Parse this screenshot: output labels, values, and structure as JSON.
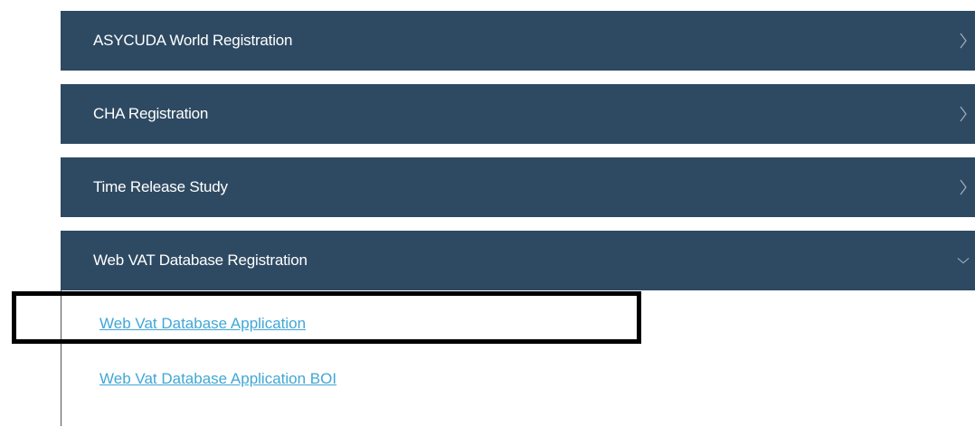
{
  "accordion": {
    "sections": [
      {
        "title": "ASYCUDA World Registration",
        "state": "collapsed",
        "icon": "chevron-right-icon"
      },
      {
        "title": "CHA Registration",
        "state": "collapsed",
        "icon": "chevron-right-icon"
      },
      {
        "title": "Time Release Study",
        "state": "collapsed",
        "icon": "chevron-right-icon"
      },
      {
        "title": "Web VAT Database Registration",
        "state": "expanded",
        "icon": "chevron-down-icon"
      }
    ],
    "expanded_links": [
      {
        "label": "Web Vat Database Application",
        "highlighted": true
      },
      {
        "label": "Web Vat Database Application BOI",
        "highlighted": false
      }
    ]
  },
  "colors": {
    "header_bg": "#2e4a62",
    "header_text": "#ffffff",
    "link": "#41a7d6",
    "highlight_border": "#000000"
  }
}
